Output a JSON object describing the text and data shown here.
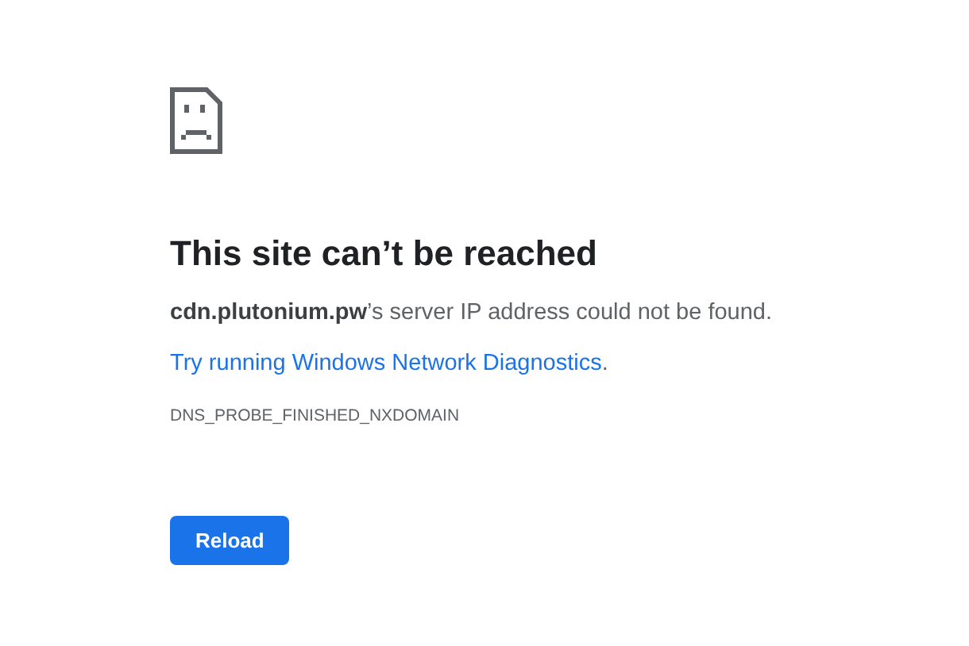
{
  "heading": "This site can’t be reached",
  "message": {
    "host": "cdn.plutonium.pw",
    "rest": "’s server IP address could not be found."
  },
  "suggestion": {
    "link": "Try running Windows Network Diagnostics",
    "after": "."
  },
  "error_code": "DNS_PROBE_FINISHED_NXDOMAIN",
  "buttons": [
    {
      "label": "Reload",
      "kind": "primary"
    }
  ]
}
